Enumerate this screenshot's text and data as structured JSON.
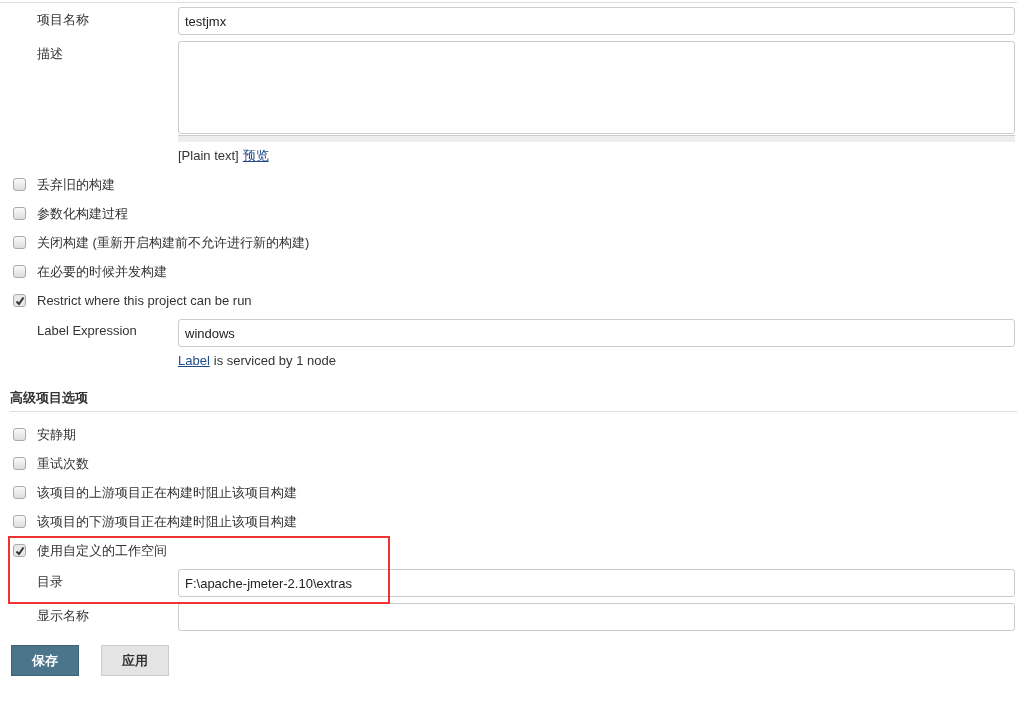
{
  "rows": [
    {
      "kind": "text",
      "label": "项目名称",
      "value": "testjmx"
    },
    {
      "kind": "textarea",
      "label": "描述",
      "format": "[Plain text]",
      "preview_link": "预览"
    },
    {
      "kind": "checkbox",
      "label": "丢弃旧的构建",
      "checked": false
    },
    {
      "kind": "checkbox",
      "label": "参数化构建过程",
      "checked": false
    },
    {
      "kind": "checkbox",
      "label": "关闭构建 (重新开启构建前不允许进行新的构建)",
      "checked": false
    },
    {
      "kind": "checkbox",
      "label": "在必要的时候并发构建",
      "checked": false
    },
    {
      "kind": "checkbox",
      "label": "Restrict where this project can be run",
      "checked": true,
      "children": [
        {
          "kind": "text",
          "label": "Label Expression",
          "value": "windows",
          "help_link": "Label",
          "help_text": "is serviced by 1 node"
        }
      ]
    },
    {
      "kind": "heading",
      "label": "高级项目选项"
    },
    {
      "kind": "checkbox",
      "label": "安静期",
      "checked": false
    },
    {
      "kind": "checkbox",
      "label": "重试次数",
      "checked": false
    },
    {
      "kind": "checkbox",
      "label": "该项目的上游项目正在构建时阻止该项目构建",
      "checked": false
    },
    {
      "kind": "checkbox",
      "label": "该项目的下游项目正在构建时阻止该项目构建",
      "checked": false
    },
    {
      "kind": "checkbox",
      "label": "使用自定义的工作空间",
      "checked": true,
      "highlighted": true,
      "children": [
        {
          "kind": "text",
          "label": "目录",
          "value": "F:\\apache-jmeter-2.10\\extras"
        }
      ]
    },
    {
      "kind": "text",
      "label": "显示名称"
    }
  ],
  "buttons": [
    {
      "label": "保存",
      "primary": true
    },
    {
      "label": "应用",
      "primary": false
    }
  ]
}
